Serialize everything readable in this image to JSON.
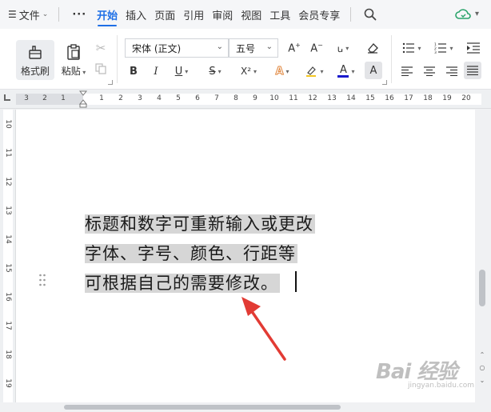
{
  "menu": {
    "file": "文件",
    "more": "···",
    "tabs": [
      "开始",
      "插入",
      "页面",
      "引用",
      "审阅",
      "视图",
      "工具",
      "会员专享"
    ],
    "active_tab": "开始"
  },
  "ribbon": {
    "format_brush": "格式刷",
    "paste": "粘贴",
    "font_name": "宋体 (正文)",
    "font_size": "五号",
    "format_buttons": [
      "B",
      "I",
      "U",
      "S",
      "X²",
      "A",
      "A",
      "A"
    ]
  },
  "ruler": {
    "left_numbers": [
      "3",
      "2",
      "1"
    ],
    "right_numbers": [
      "1",
      "2",
      "4",
      "6",
      "8",
      "10",
      "12",
      "14",
      "16",
      "18",
      "20"
    ],
    "full_numbers": [
      "1",
      "2",
      "3",
      "4",
      "5",
      "6",
      "7",
      "8",
      "9",
      "10",
      "11",
      "12",
      "13",
      "14",
      "15",
      "16",
      "17",
      "18",
      "19",
      "20"
    ]
  },
  "vertical_ruler": [
    "10",
    "11",
    "12",
    "13",
    "14",
    "15",
    "16",
    "17",
    "18",
    "19"
  ],
  "document": {
    "lines": [
      "标题和数字可重新输入或更改",
      "字体、字号、颜色、行距等",
      "可根据自己的需要修改。"
    ]
  },
  "watermark": {
    "brand": "Bai 经验",
    "url": "jingyan.baidu.com"
  },
  "colors": {
    "accent": "#1e6fe6",
    "arrow": "#e23b34",
    "selection": "#d6d6d6",
    "font_color_bar": "#1a1acc"
  }
}
